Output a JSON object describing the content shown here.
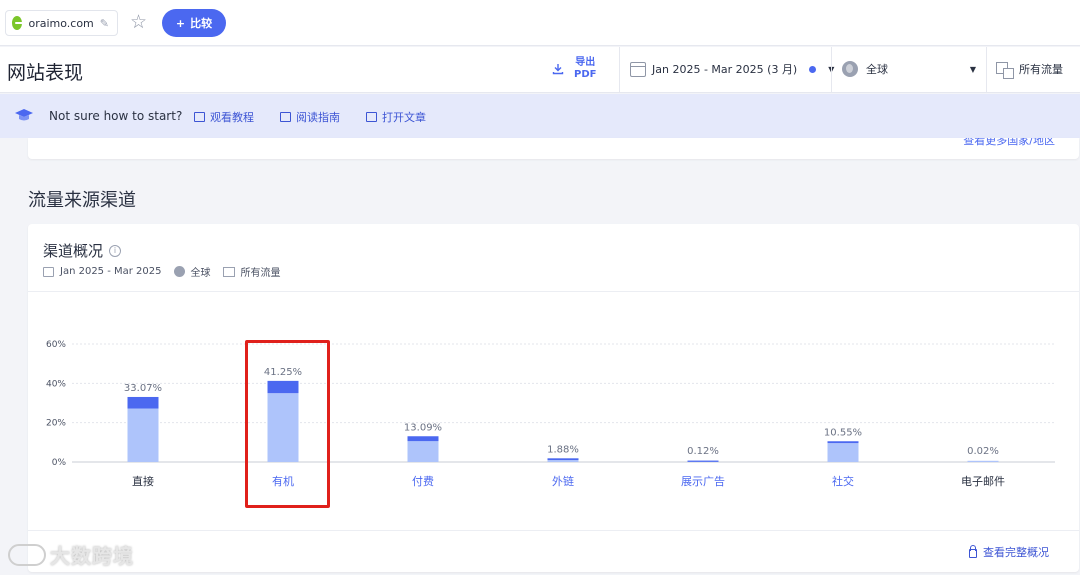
{
  "topbar": {
    "domain": "oraimo.com",
    "compare_label": "比较",
    "compare_plus": "+",
    "pencil_glyph": "✎",
    "star_glyph": "☆"
  },
  "header": {
    "title": "网站表现",
    "export_line1": "导出",
    "export_line2": "PDF",
    "date_range": "Jan 2025 - Mar 2025 (3 月)",
    "region": "全球",
    "traffic": "所有流量"
  },
  "banner": {
    "question": "Not sure how to start?",
    "link_tutorial": "观看教程",
    "link_guide": "阅读指南",
    "link_article": "打开文章"
  },
  "top_card": {
    "more_link": "查看更多国家/地区"
  },
  "section": {
    "title": "流量来源渠道"
  },
  "card": {
    "title": "渠道概况",
    "meta_date": "Jan 2025 - Mar 2025",
    "meta_region": "全球",
    "meta_traffic": "所有流量",
    "view_full": "查看完整概况"
  },
  "chart_data": {
    "type": "bar",
    "stacked": true,
    "categories": [
      "直接",
      "有机",
      "付费",
      "外链",
      "展示广告",
      "社交",
      "电子邮件"
    ],
    "totals": [
      33.07,
      41.25,
      13.09,
      1.88,
      0.12,
      10.55,
      0.02
    ],
    "value_labels": [
      "33.07%",
      "41.25%",
      "13.09%",
      "1.88%",
      "0.12%",
      "10.55%",
      "0.02%"
    ],
    "series": [
      {
        "values": [
          27.2,
          35.0,
          10.6,
          1.0,
          0.1,
          9.6,
          0.02
        ],
        "color": "#aec4fb"
      },
      {
        "values": [
          5.87,
          6.25,
          2.49,
          0.88,
          0.02,
          0.95,
          0.0
        ],
        "color": "#4b68f0"
      }
    ],
    "ylim": [
      0,
      60
    ],
    "yticks": [
      "0%",
      "20%",
      "40%",
      "60%"
    ],
    "ytick_values": [
      0,
      20,
      40,
      60
    ],
    "grid": true,
    "category_colors": {
      "default": "#2a3142",
      "link": "#4b68f0"
    },
    "linked_categories": [
      "有机",
      "付费",
      "外链",
      "展示广告",
      "社交"
    ],
    "highlighted_category": "有机"
  },
  "watermark": {
    "text": "大数跨境"
  }
}
